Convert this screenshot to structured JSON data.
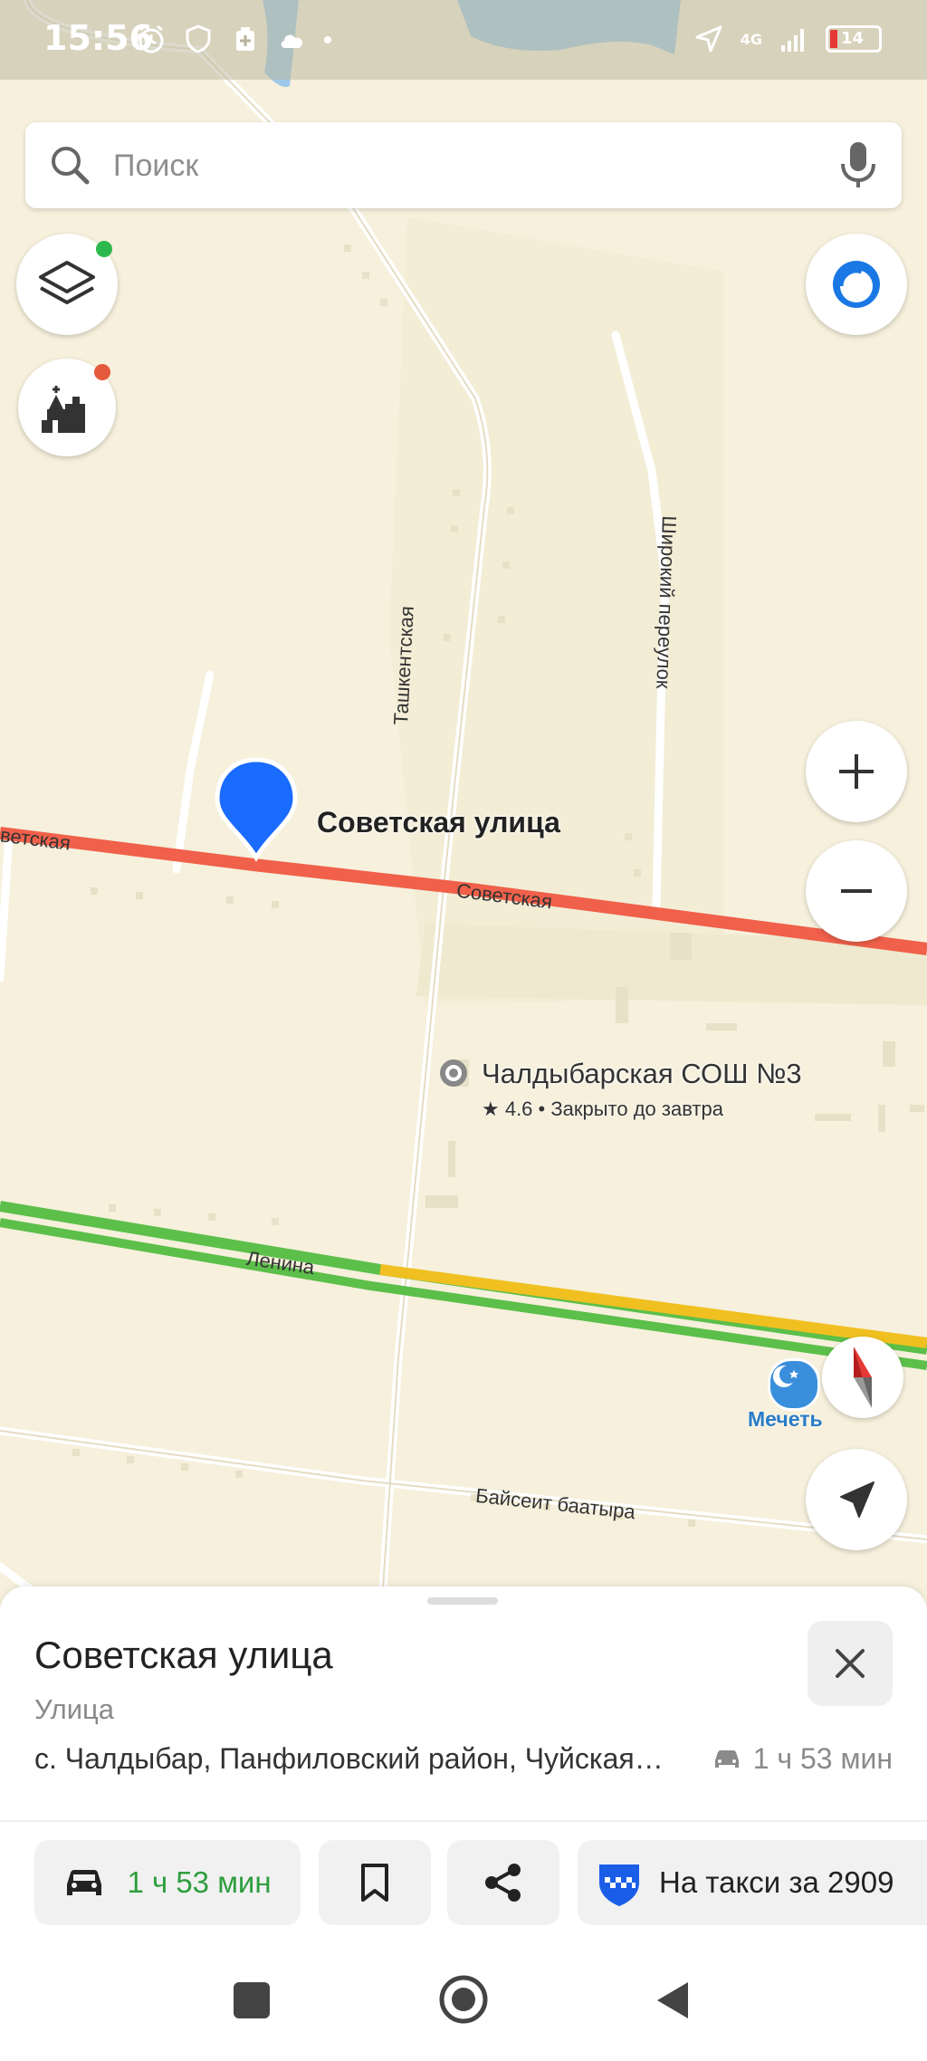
{
  "status_bar": {
    "time": "15:56",
    "network": "4G",
    "battery": "14"
  },
  "search": {
    "placeholder": "Поиск"
  },
  "map": {
    "labels": {
      "sovetskaya_left": "ветская",
      "sovetskaya_center": "Советская",
      "tashkentskaya": "Ташкентская",
      "shirokiy": "Широкий переулок",
      "lenina": "Ленина",
      "baiseit": "Байсеит баатыра"
    },
    "pin_label": "Советская улица",
    "poi": {
      "name": "Чалдыбарская СОШ №3",
      "details": "★ 4.6 • Закрыто до завтра"
    },
    "mosque": "Мечеть",
    "colors": {
      "road_red": "#f0604a",
      "road_green": "#5cbf4a",
      "road_yellow": "#f0c020",
      "pin": "#1a6bff"
    }
  },
  "sheet": {
    "title": "Советская улица",
    "subtitle": "Улица",
    "address": "с. Чалдыбар, Панфиловский район, Чуйская область",
    "eta_small": "1 ч 53 мин",
    "route_label": "1 ч 53 мин",
    "taxi_label": "На такси за 2909"
  },
  "icons": [
    "search-icon",
    "microphone-icon",
    "layers-icon",
    "landmarks-icon",
    "alice-icon",
    "zoom-in-icon",
    "zoom-out-icon",
    "compass-icon",
    "my-location-icon",
    "car-icon",
    "bookmark-icon",
    "share-icon",
    "taxi-icon",
    "close-icon"
  ]
}
